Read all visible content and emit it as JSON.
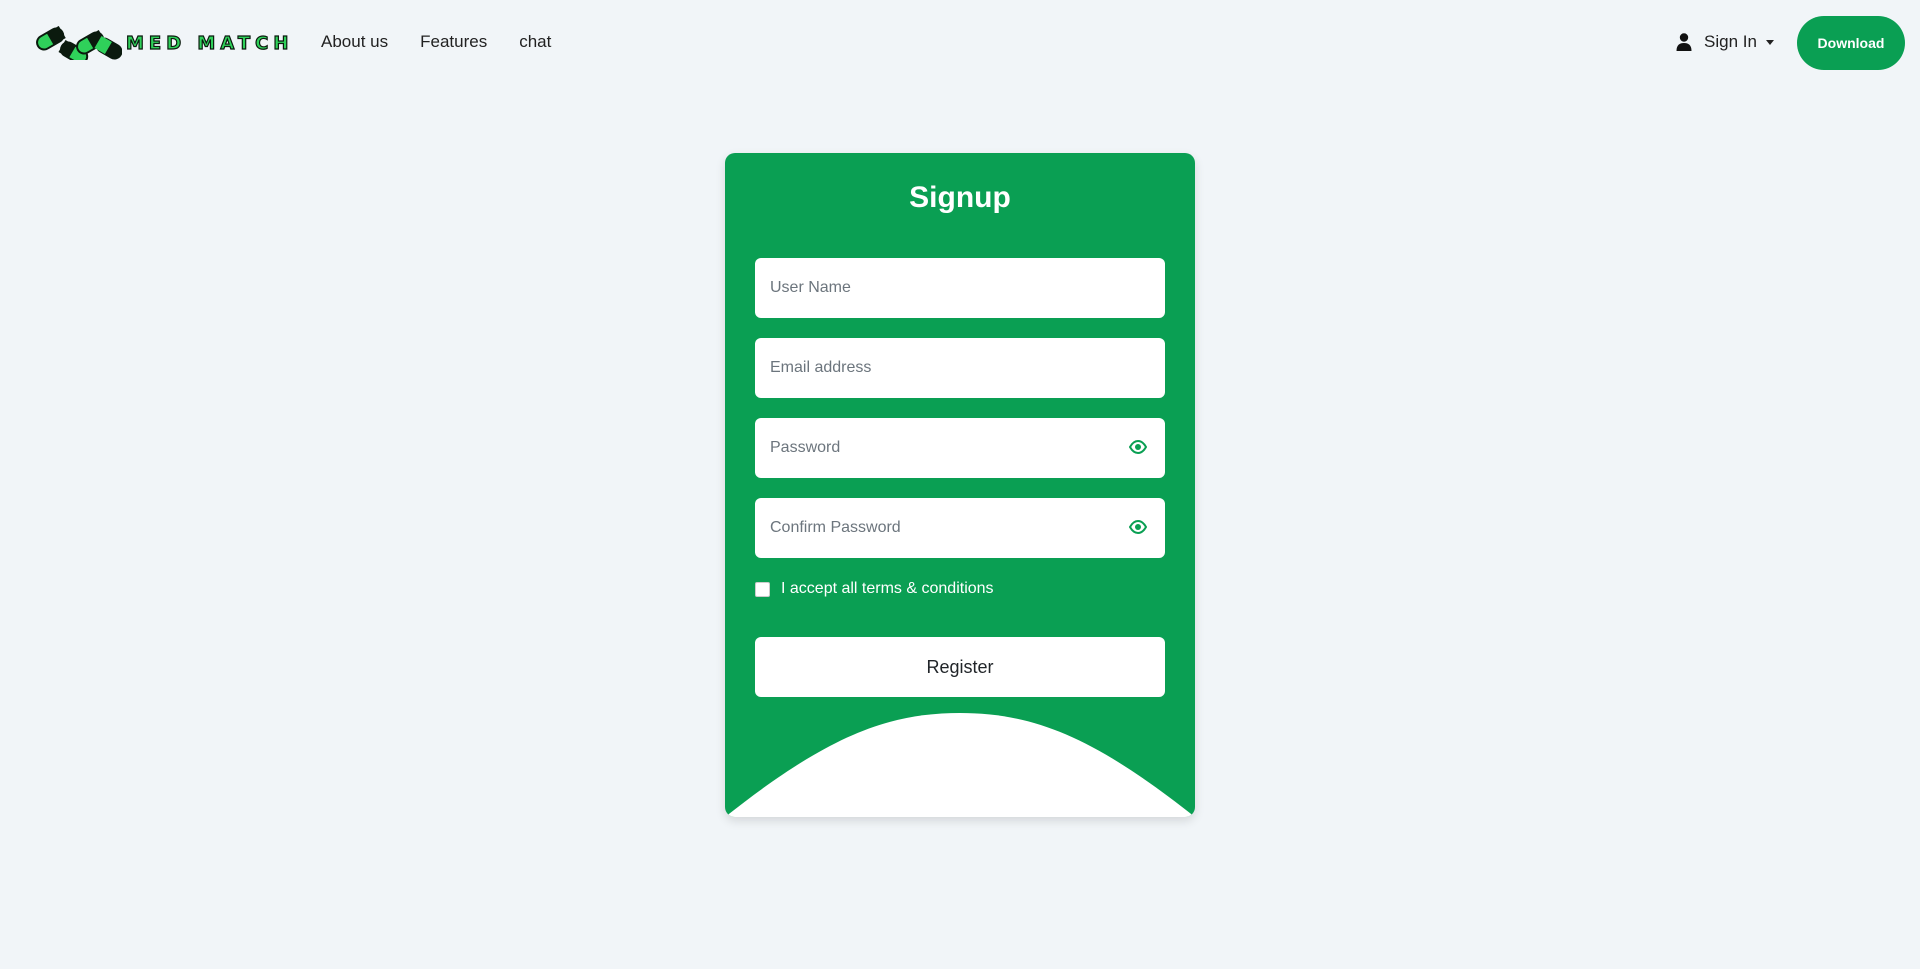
{
  "brand": {
    "name": "MED MATCH",
    "logo_icon": "pill-capsules-logo",
    "colors": {
      "primary": "#0a9f53",
      "logo_green": "#2fd15a",
      "background": "#f1f5f8"
    }
  },
  "nav": {
    "links": [
      {
        "label": "About us"
      },
      {
        "label": "Features"
      },
      {
        "label": "chat"
      }
    ],
    "signin": {
      "label": "Sign In",
      "icon": "user-icon",
      "caret_icon": "caret-down-icon"
    },
    "download": {
      "label": "Download"
    }
  },
  "signup": {
    "title": "Signup",
    "fields": {
      "username": {
        "placeholder": "User Name",
        "value": ""
      },
      "email": {
        "placeholder": "Email address",
        "value": ""
      },
      "password": {
        "placeholder": "Password",
        "value": "",
        "toggle_icon": "eye-icon"
      },
      "confirm_password": {
        "placeholder": "Confirm Password",
        "value": "",
        "toggle_icon": "eye-icon"
      }
    },
    "terms": {
      "label": "I accept all terms & conditions",
      "checked": false
    },
    "register": {
      "label": "Register"
    }
  }
}
